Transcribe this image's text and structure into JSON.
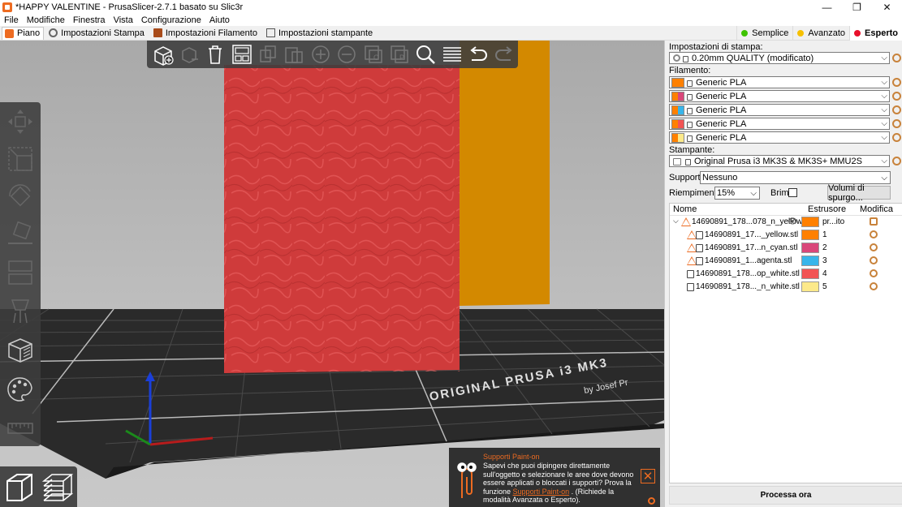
{
  "window": {
    "title": "*HAPPY VALENTINE - PrusaSlicer-2.7.1 basato su Slic3r",
    "minimize": "—",
    "maximize": "❐",
    "close": "✕"
  },
  "menu": [
    "File",
    "Modifiche",
    "Finestra",
    "Vista",
    "Configurazione",
    "Aiuto"
  ],
  "tabs": [
    "Piano",
    "Impostazioni Stampa",
    "Impostazioni Filamento",
    "Impostazioni stampante"
  ],
  "modes": [
    {
      "label": "Semplice",
      "color": "#3ec300"
    },
    {
      "label": "Avanzato",
      "color": "#f6c000"
    },
    {
      "label": "Esperto",
      "color": "#e8102b"
    }
  ],
  "bed": {
    "brand_text": "ORIGINAL PRUSA i3 MK3",
    "sub_text": "by Josef Pr"
  },
  "notification": {
    "title": "Supporti Paint-on",
    "body": "Sapevi che puoi dipingere direttamente sull'oggetto e selezionare le aree dove devono essere applicati o bloccati i supporti? Prova la funzione",
    "link": "Supporti Paint-on",
    "tail": ". (Richiede la modalità Avanzata o Esperto).",
    "close": "✕"
  },
  "sidebar": {
    "print_settings_label": "Impostazioni di stampa:",
    "print_profile": "0.20mm QUALITY (modificato)",
    "filament_label": "Filamento:",
    "filaments": [
      {
        "name": "Generic PLA",
        "color": "#ff8000"
      },
      {
        "name": "Generic PLA",
        "color": "#d9477a"
      },
      {
        "name": "Generic PLA",
        "color": "#37b5ea"
      },
      {
        "name": "Generic PLA",
        "color": "#f25454"
      },
      {
        "name": "Generic PLA",
        "color": "#fce98a"
      }
    ],
    "printer_label": "Stampante:",
    "printer": "Original Prusa i3 MK3S & MK3S+ MMU2S",
    "supports_label": "Supporti:",
    "supports_value": "Nessuno",
    "infill_label": "Riempimento:",
    "infill_value": "15%",
    "brim_label": "Brim:",
    "purge_button": "Volumi di spurgo...",
    "slice_button": "Processa ora"
  },
  "object_list": {
    "headers": {
      "name": "Nome",
      "extruder": "Estrusore",
      "modify": "Modifica"
    },
    "rows": [
      {
        "name": "14690891_178...078_n_yellow",
        "extruder": "pr...ito",
        "color": "#ff8000",
        "level": 0,
        "warn": true
      },
      {
        "name": "14690891_17..._yellow.stl",
        "extruder": "1",
        "color": "#ff8000",
        "level": 1,
        "warn": true
      },
      {
        "name": "14690891_17...n_cyan.stl",
        "extruder": "2",
        "color": "#d9477a",
        "level": 1,
        "warn": true
      },
      {
        "name": "14690891_1...agenta.stl",
        "extruder": "3",
        "color": "#37b5ea",
        "level": 1,
        "warn": true
      },
      {
        "name": "14690891_178...op_white.stl",
        "extruder": "4",
        "color": "#f25454",
        "level": 1,
        "warn": false
      },
      {
        "name": "14690891_178..._n_white.stl",
        "extruder": "5",
        "color": "#fce98a",
        "level": 1,
        "warn": false
      }
    ]
  }
}
